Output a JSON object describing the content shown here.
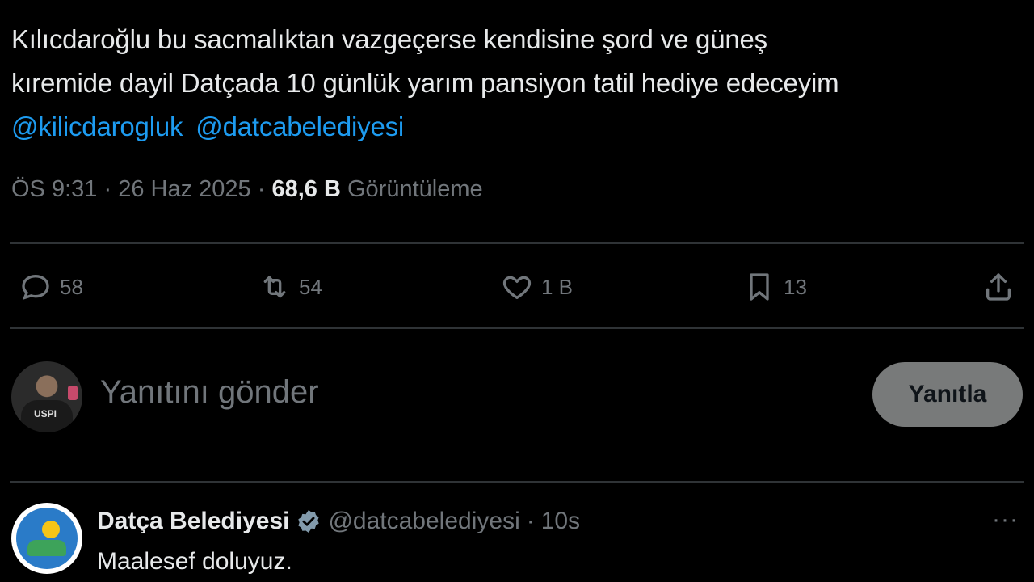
{
  "tweet": {
    "lines": [
      "Kılıcdaroğlu bu sacmalıktan  vazgeçerse  kendisine şord ve güneş",
      "kıremide dayil Datçada  10 günlük yarım pansiyon tatil hediye edeceyim"
    ],
    "mentions": [
      "@kilicdarogluk",
      "@datcabelediyesi"
    ],
    "time": "ÖS 9:31",
    "date": "26 Haz 2025",
    "separator": "·",
    "views": "68,6 B",
    "views_label": "Görüntüleme"
  },
  "actions": {
    "reply_count": "58",
    "retweet_count": "54",
    "like_count": "1 B",
    "bookmark_count": "13"
  },
  "composer": {
    "placeholder": "Yanıtını gönder",
    "button_label": "Yanıtla"
  },
  "reply": {
    "display_name": "Datça Belediyesi",
    "handle": "@datcabelediyesi",
    "separator": "·",
    "time": "10s",
    "text": "Maalesef doluyuz.",
    "more_label": "···",
    "avatar_text": "USPI"
  },
  "colors": {
    "background": "#000000",
    "text": "#e7e9ea",
    "muted": "#71767b",
    "link": "#1d9bf0",
    "divider": "#2f3336",
    "verified": "#829aab",
    "button": "#787a7a"
  },
  "icons": {
    "reply": "speech-bubble-icon",
    "retweet": "retweet-icon",
    "like": "heart-icon",
    "bookmark": "bookmark-icon",
    "share": "share-icon",
    "verified": "verified-badge-icon",
    "more": "more-icon"
  }
}
